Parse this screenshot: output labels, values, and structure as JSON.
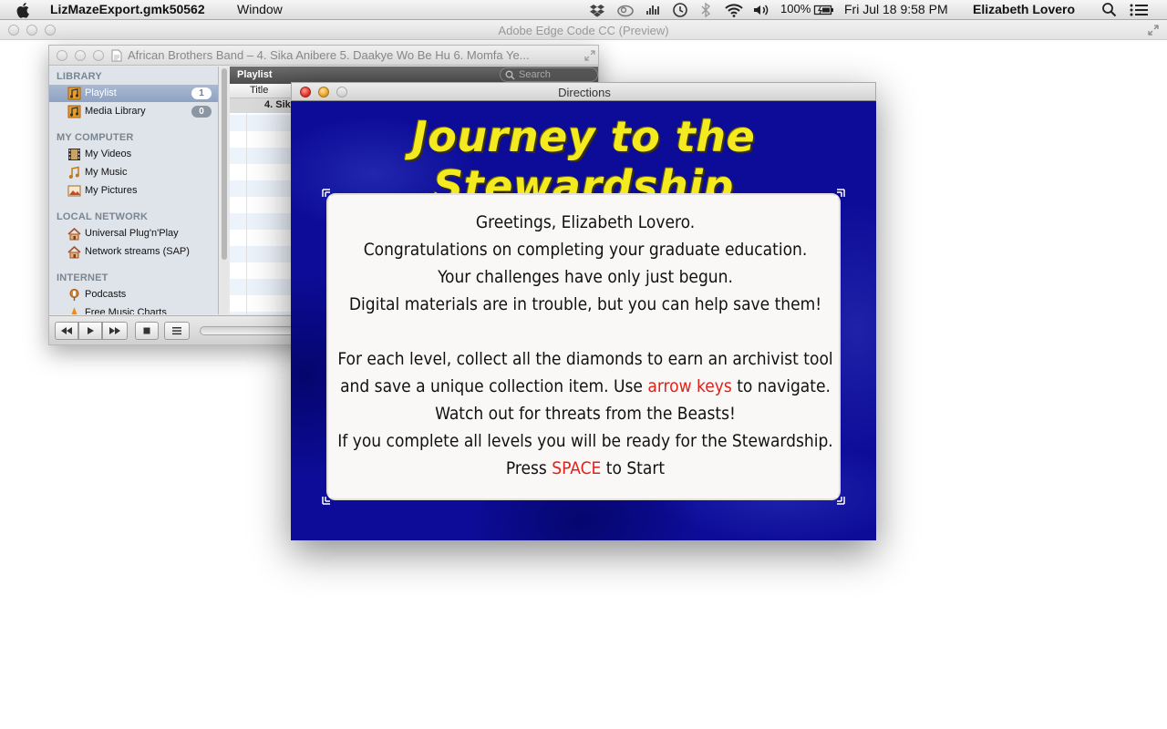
{
  "menubar": {
    "app_name": "LizMazeExport.gmk50562",
    "menu_window": "Window",
    "battery": "100%",
    "datetime": "Fri Jul 18  9:58 PM",
    "user": "Elizabeth Lovero"
  },
  "main_window": {
    "title": "Adobe Edge Code CC (Preview)"
  },
  "vlc": {
    "title": "African Brothers Band – 4. Sika Anibere  5. Daakye Wo Be Hu  6. Momfa Ye...",
    "sections": {
      "library": "LIBRARY",
      "my_computer": "MY COMPUTER",
      "local_network": "LOCAL NETWORK",
      "internet": "INTERNET"
    },
    "items": {
      "playlist": "Playlist",
      "playlist_count": "1",
      "media_library": "Media Library",
      "media_library_count": "0",
      "my_videos": "My Videos",
      "my_music": "My Music",
      "my_pictures": "My Pictures",
      "upnp": "Universal Plug'n'Play",
      "sap": "Network streams (SAP)",
      "podcasts": "Podcasts",
      "free_music": "Free Music Charts"
    },
    "playlist_header": "Playlist",
    "search_placeholder": "Search",
    "column_title": "Title",
    "row1": "4. Sik"
  },
  "directions": {
    "window_title": "Directions",
    "game_title": "Journey to the Stewardship",
    "line1": "Greetings, Elizabeth Lovero.",
    "line2": "Congratulations on completing your graduate education.",
    "line3": "Your challenges have only just begun.",
    "line4": "Digital materials are in trouble, but you can help save them!",
    "line5": "For each level, collect all the diamonds to earn an archivist tool",
    "line6a": "and save a unique collection item. Use ",
    "line6b": "arrow keys",
    "line6c": " to navigate.",
    "line7": "Watch out for threats from the Beasts!",
    "line8": "If you complete all levels you will be ready for the Stewardship.",
    "line9a": "Press ",
    "line9b": "SPACE",
    "line9c": " to Start"
  },
  "colors": {
    "game_background": "#0c0c98",
    "title_yellow": "#f3ea20",
    "highlight_red": "#e2201b"
  }
}
